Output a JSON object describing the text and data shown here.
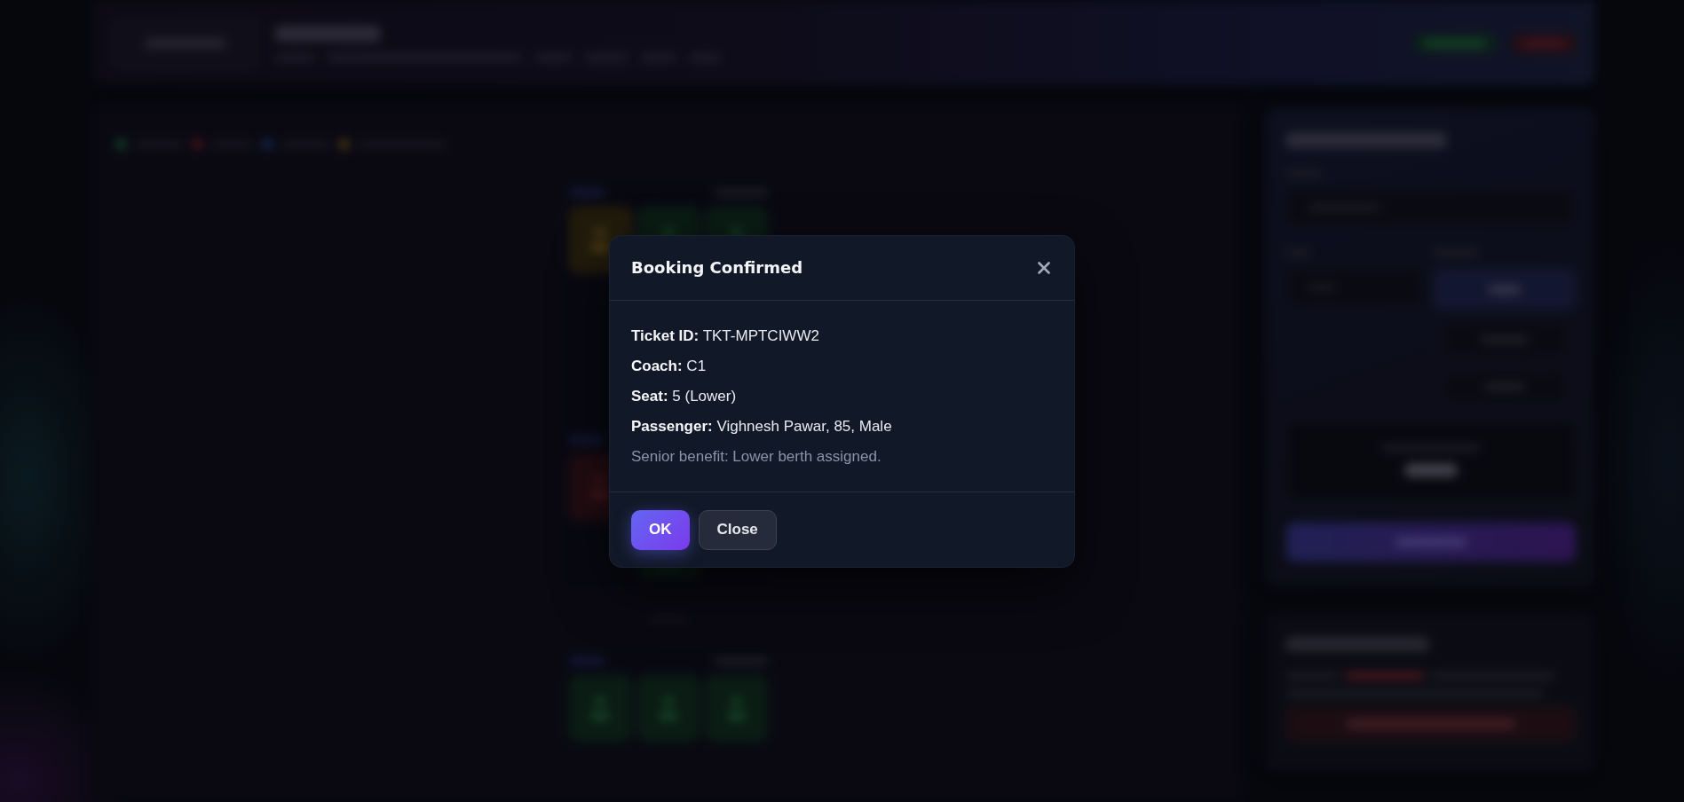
{
  "dialog": {
    "title": "Booking Confirmed",
    "details": [
      "**Ticket ID:** TKT-MPTCIWW2",
      "**Coach:** C1",
      "**Seat:** 5 (Lower)",
      "**Passenger:** Vighnesh Pawar, 85, Male"
    ],
    "note": "Senior benefit: Lower berth assigned.",
    "buttons": [
      {
        "label": "OK",
        "kind": "primary"
      },
      {
        "label": "Close",
        "kind": "secondary"
      }
    ]
  }
}
